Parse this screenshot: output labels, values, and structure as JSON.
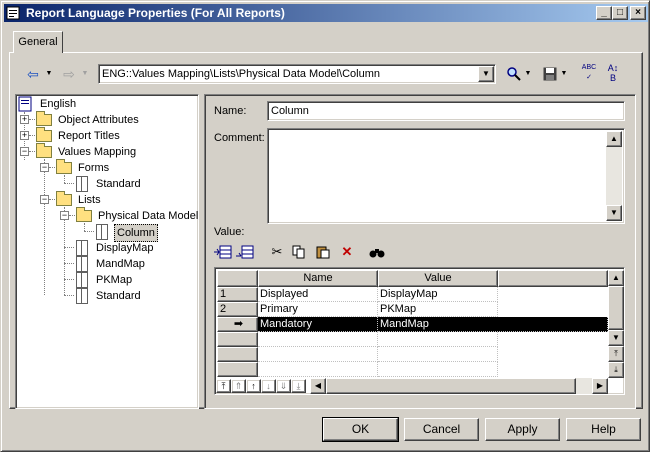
{
  "window": {
    "title": "Report Language Properties (For All Reports)",
    "minimize": "_",
    "maximize": "□",
    "close": "×"
  },
  "tabs": [
    {
      "label": "General"
    }
  ],
  "toolbar": {
    "path": "ENG::Values Mapping\\Lists\\Physical Data Model\\Column"
  },
  "tree": {
    "root": "English",
    "items": {
      "object_attributes": "Object Attributes",
      "report_titles": "Report Titles",
      "values_mapping": "Values Mapping",
      "forms": "Forms",
      "forms_standard": "Standard",
      "lists": "Lists",
      "physical_data_model": "Physical Data Model",
      "column": "Column",
      "display_map": "DisplayMap",
      "mand_map": "MandMap",
      "pk_map": "PKMap",
      "lists_standard": "Standard"
    }
  },
  "form": {
    "name_label": "Name:",
    "name_value": "Column",
    "comment_label": "Comment:",
    "comment_value": "",
    "value_label": "Value:"
  },
  "grid": {
    "columns": [
      "Name",
      "Value"
    ],
    "rows": [
      {
        "num": "1",
        "name": "Displayed",
        "value": "DisplayMap"
      },
      {
        "num": "2",
        "name": "Primary",
        "value": "PKMap"
      },
      {
        "num": "➡",
        "name": "Mandatory",
        "value": "MandMap"
      }
    ],
    "selected_row": 3
  },
  "buttons": {
    "ok": "OK",
    "cancel": "Cancel",
    "apply": "Apply",
    "help": "Help"
  }
}
